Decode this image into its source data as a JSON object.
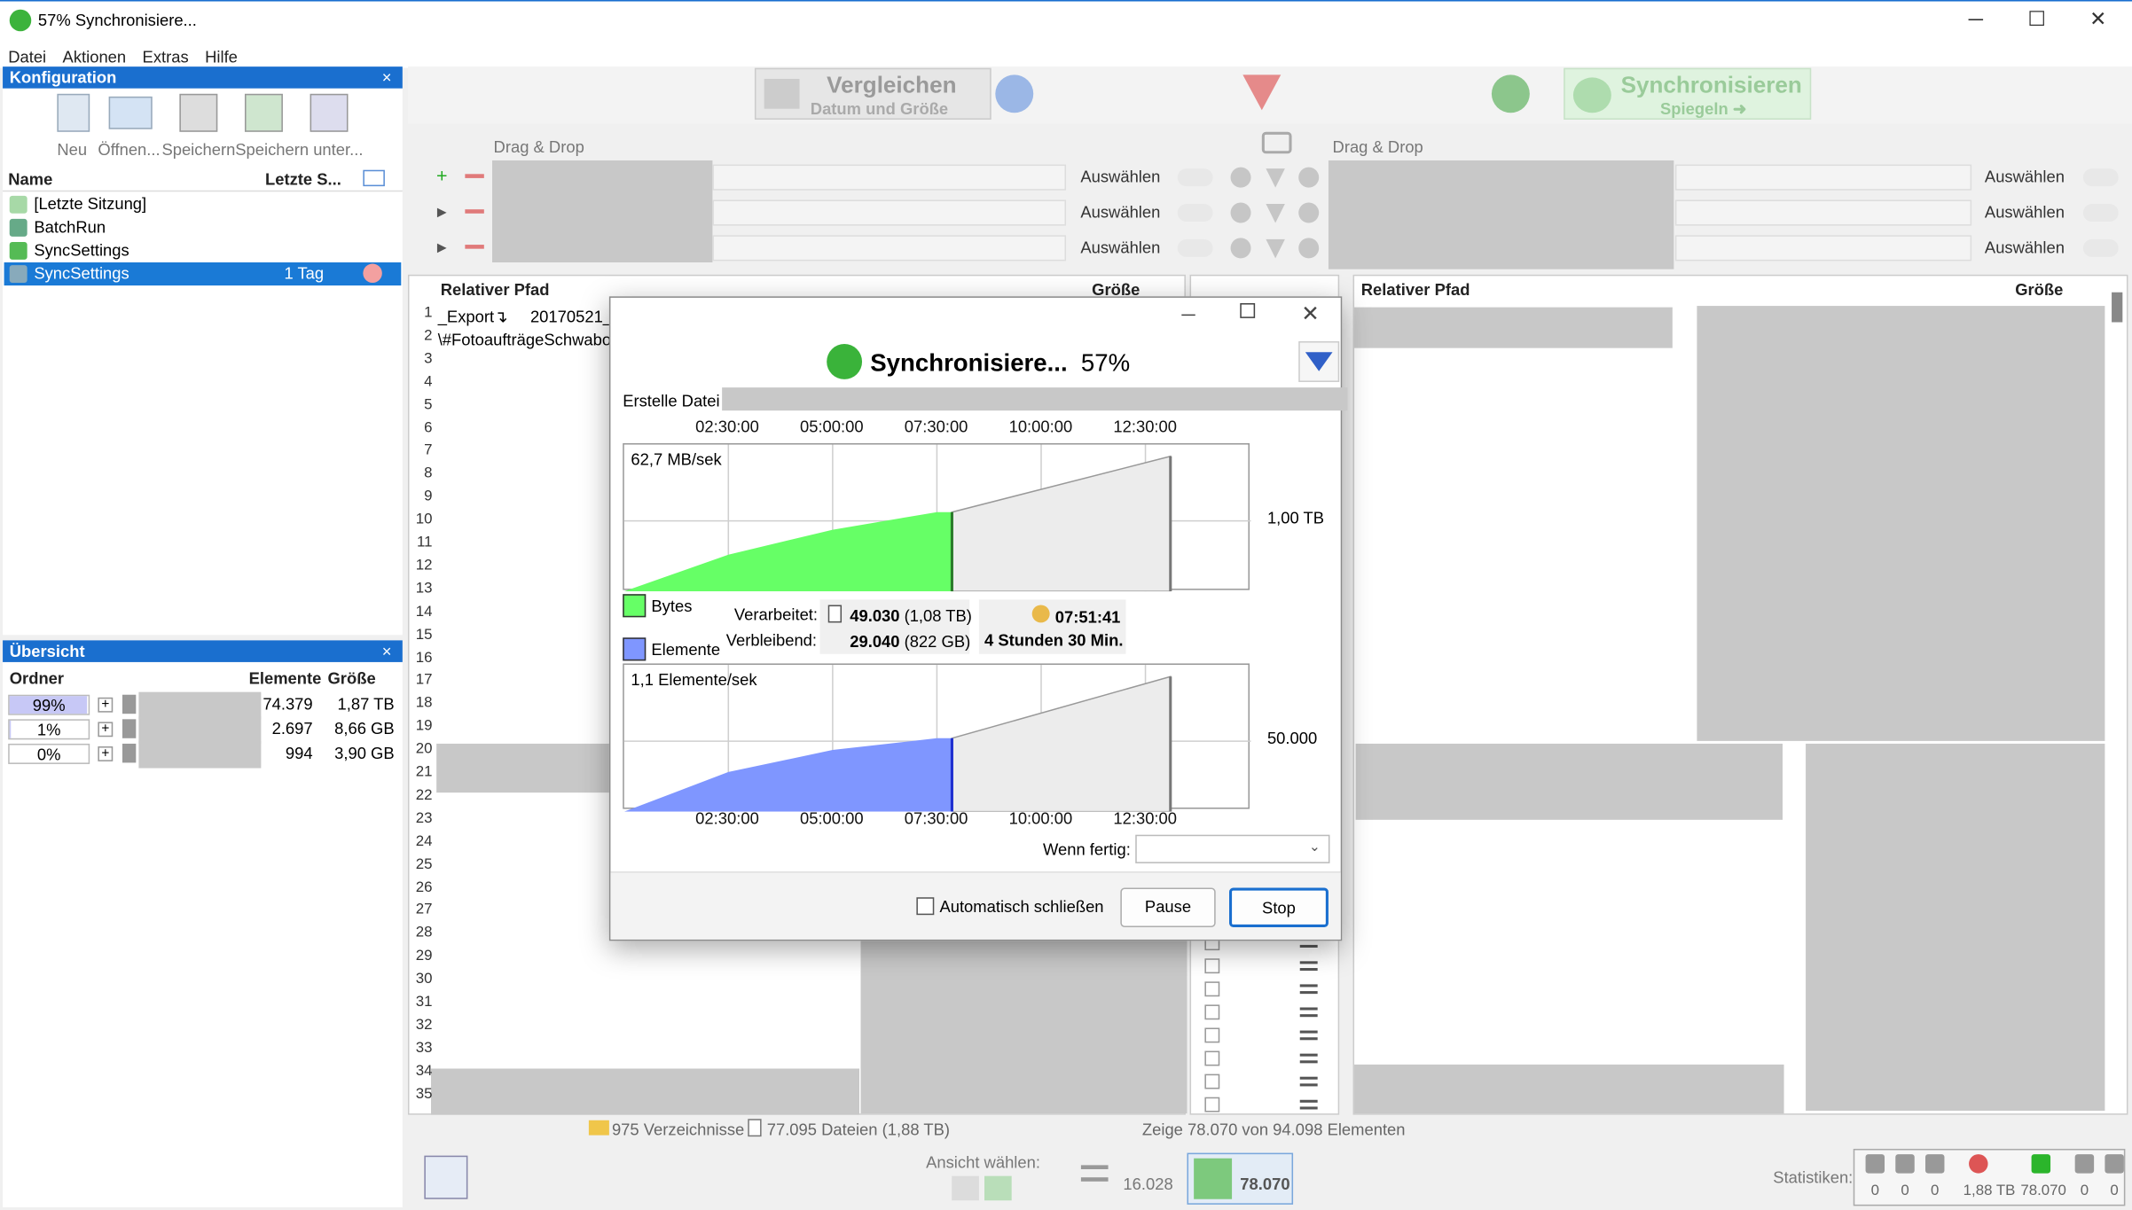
{
  "window": {
    "title": "57% Synchronisiere...",
    "minimize": "─",
    "maximize": "☐",
    "close": "✕"
  },
  "menu": [
    "Datei",
    "Aktionen",
    "Extras",
    "Hilfe"
  ],
  "config_panel": {
    "title": "Konfiguration",
    "close": "×",
    "toolbar": [
      "Neu",
      "Öffnen...",
      "Speichern",
      "Speichern unter..."
    ],
    "col_name": "Name",
    "col_last": "Letzte S...",
    "items": [
      {
        "name": "[Letzte Sitzung]",
        "last": ""
      },
      {
        "name": "BatchRun",
        "last": ""
      },
      {
        "name": "SyncSettings",
        "last": ""
      },
      {
        "name": "SyncSettings",
        "last": "1 Tag"
      }
    ]
  },
  "overview_panel": {
    "title": "Übersicht",
    "close": "×",
    "col_folder": "Ordner",
    "col_items": "Elemente",
    "col_size": "Größe",
    "rows": [
      {
        "pct": "99%",
        "fill": 0.99,
        "items": "74.379",
        "size": "1,87 TB"
      },
      {
        "pct": "1%",
        "fill": 0.01,
        "items": "2.697",
        "size": "8,66 GB"
      },
      {
        "pct": "0%",
        "fill": 0,
        "items": "994",
        "size": "3,90 GB"
      }
    ]
  },
  "top_toolbar": {
    "compare_label": "Vergleichen",
    "compare_sub": "Datum und Größe",
    "sync_label": "Synchronisieren",
    "sync_sub": "Spiegeln ➜"
  },
  "folder_pairs": {
    "drag_drop": "Drag & Drop",
    "select": "Auswählen"
  },
  "grid": {
    "left_col_path": "Relativer Pfad",
    "left_col_size": "Größe",
    "right_col_path": "Relativer Pfad",
    "right_col_size": "Größe",
    "row1_a": "_Export↴",
    "row1_b": "20170521_A",
    "row2": "\\#FotoaufträgeSchwabo\\"
  },
  "status_bar": {
    "dirs": "975 Verzeichnisse",
    "files": "77.095 Dateien (1,88 TB)",
    "shown": "Zeige 78.070 von 94.098 Elementen"
  },
  "bottom_bar": {
    "view_label": "Ansicht wählen:",
    "equal_count": "16.028",
    "create_count": "78.070",
    "stats_label": "Statistiken:",
    "stats": [
      "0",
      "0",
      "0",
      "1,88 TB",
      "78.070",
      "0",
      "0"
    ]
  },
  "dialog": {
    "title": "Synchronisiere...",
    "percent": "57%",
    "status_prefix": "Erstelle Datei",
    "bytes_legend": "Bytes",
    "items_legend": "Elemente",
    "processed_label": "Verarbeitet:",
    "remaining_label": "Verbleibend:",
    "processed_count": "49.030",
    "processed_size": "(1,08 TB)",
    "remaining_count": "29.040",
    "remaining_size": "(822 GB)",
    "elapsed": "07:51:41",
    "remaining_time": "4 Stunden 30 Min.",
    "when_done": "Wenn fertig:",
    "auto_close": "Automatisch schließen",
    "pause": "Pause",
    "stop": "Stop",
    "colors": {
      "bytes": "#66ff66",
      "items": "#7f96ff"
    }
  },
  "chart_data": [
    {
      "type": "area",
      "title": "",
      "series": [
        {
          "name": "Bytes",
          "x": [
            "00:00:00",
            "02:30:00",
            "05:00:00",
            "07:30:00"
          ],
          "y_fraction": [
            0,
            0.25,
            0.42,
            0.54
          ]
        }
      ],
      "x_ticks": [
        "02:30:00",
        "05:00:00",
        "07:30:00",
        "10:00:00",
        "12:30:00"
      ],
      "rate_label": "62,7 MB/sek",
      "y_tick": "1,00 TB",
      "progress": 0.57
    },
    {
      "type": "area",
      "title": "",
      "series": [
        {
          "name": "Elemente",
          "x": [
            "00:00:00",
            "02:30:00",
            "05:00:00",
            "07:30:00"
          ],
          "y_fraction": [
            0,
            0.27,
            0.42,
            0.5
          ]
        }
      ],
      "x_ticks": [
        "02:30:00",
        "05:00:00",
        "07:30:00",
        "10:00:00",
        "12:30:00"
      ],
      "rate_label": "1,1 Elemente/sek",
      "y_tick": "50.000",
      "progress": 0.57
    }
  ]
}
